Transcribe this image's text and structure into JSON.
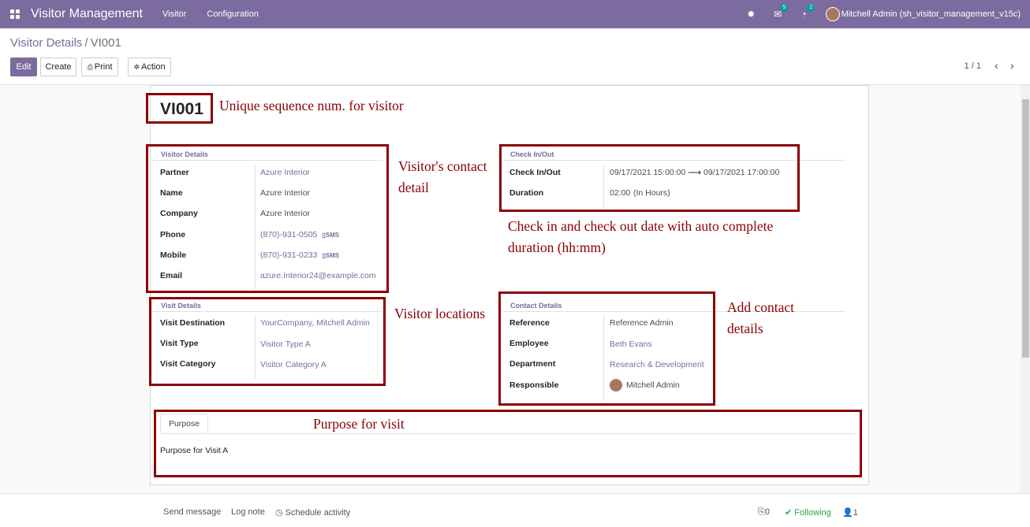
{
  "navbar": {
    "app_title": "Visitor Management",
    "menus": [
      "Visitor",
      "Configuration"
    ],
    "messages_count": "5",
    "activities_count": "2",
    "user": "Mitchell Admin (sh_visitor_management_v15c)"
  },
  "breadcrumb": {
    "parent": "Visitor Details",
    "separator": "/",
    "current": "VI001"
  },
  "toolbar": {
    "edit": "Edit",
    "create": "Create",
    "print": "Print",
    "action": "Action"
  },
  "pager": {
    "value": "1 / 1"
  },
  "record": {
    "sequence": "VI001"
  },
  "visitor_details": {
    "title": "Visitor Details",
    "fields": [
      {
        "label": "Partner",
        "value": "Azure Interior"
      },
      {
        "label": "Name",
        "value": "Azure Interior"
      },
      {
        "label": "Company",
        "value": "Azure Interior"
      },
      {
        "label": "Phone",
        "value": "(870)-931-0505"
      },
      {
        "label": "Mobile",
        "value": "(870)-931-0233"
      },
      {
        "label": "Email",
        "value": "azure.Interior24@example.com"
      }
    ],
    "sms_label": "SMS"
  },
  "check_in_out": {
    "title": "Check In/Out",
    "check_label": "Check In/Out",
    "check_in": "09/17/2021 15:00:00",
    "check_out": "09/17/2021 17:00:00",
    "duration_label": "Duration",
    "duration_value": "02:00",
    "duration_unit": "(In Hours)"
  },
  "visit_details": {
    "title": "Visit Details",
    "fields": [
      {
        "label": "Visit Destination",
        "value": "YourCompany, Mitchell Admin"
      },
      {
        "label": "Visit Type",
        "value": "Visitor Type A"
      },
      {
        "label": "Visit Category",
        "value": "Visitor Category A"
      }
    ]
  },
  "contact_details": {
    "title": "Contact Details",
    "fields": [
      {
        "label": "Reference",
        "value": "Reference Admin"
      },
      {
        "label": "Employee",
        "value": "Beth Evans"
      },
      {
        "label": "Department",
        "value": "Research & Development"
      },
      {
        "label": "Responsible",
        "value": "Mitchell Admin"
      }
    ]
  },
  "notebook": {
    "tab": "Purpose",
    "content": "Purpose for Visit A"
  },
  "annotations": {
    "sequence": "Unique sequence num. for visitor",
    "contact_1": "Visitor's contact",
    "contact_2": "detail",
    "checkinout_1": "Check in and check out date with auto complete",
    "checkinout_2": "duration (hh:mm)",
    "locations": "Visitor locations",
    "add_contact_1": "Add contact",
    "add_contact_2": "details",
    "purpose": "Purpose for visit"
  },
  "chatter": {
    "send_message": "Send message",
    "log_note": "Log note",
    "schedule_activity": "Schedule activity",
    "attachments": "0",
    "following": "Following",
    "followers": "1"
  },
  "colors": {
    "brand": "#7c6b9e",
    "annotation": "#8b0000",
    "following": "#28a745"
  }
}
